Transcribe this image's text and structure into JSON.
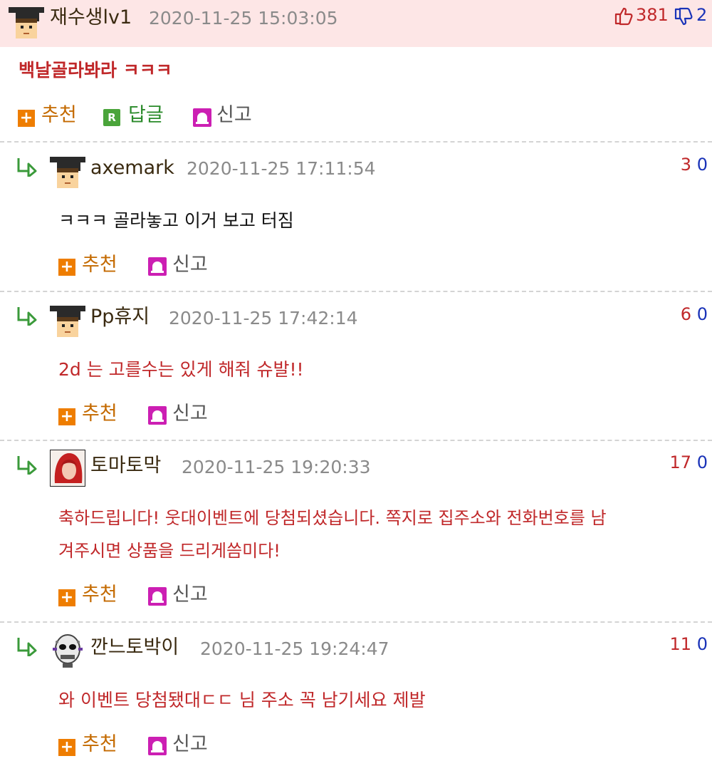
{
  "main_comment": {
    "author": "재수생lv1",
    "timestamp": "2020-11-25 15:03:05",
    "upvotes": "381",
    "downvotes": "2",
    "text": "백날골라봐라 ㅋㅋㅋ",
    "actions": {
      "recommend": "추천",
      "reply": "답글",
      "report": "신고"
    }
  },
  "replies": [
    {
      "author": "axemark",
      "timestamp": "2020-11-25 17:11:54",
      "up": "3",
      "down": "0",
      "lines": [
        "ㅋㅋㅋ 골라놓고 이거 보고 터짐"
      ],
      "recommend": "추천",
      "report": "신고"
    },
    {
      "author": "Pp휴지",
      "timestamp": "2020-11-25 17:42:14",
      "up": "6",
      "down": "0",
      "lines": [
        "2d 는 고를수는 있게 해줘 슈발!!"
      ],
      "recommend": "추천",
      "report": "신고"
    },
    {
      "author": "토마토막",
      "timestamp": "2020-11-25 19:20:33",
      "up": "17",
      "down": "0",
      "lines": [
        "축하드립니다! 웃대이벤트에 당첨되셨습니다. 쪽지로 집주소와 전화번호를 남",
        "겨주시면 상품을 드리게씀미다!"
      ],
      "recommend": "추천",
      "report": "신고"
    },
    {
      "author": "깐느토박이",
      "timestamp": "2020-11-25 19:24:47",
      "up": "11",
      "down": "0",
      "lines": [
        "와 이벤트 당첨됐대ㄷㄷ 님 주소 꼭 남기세요 제발"
      ],
      "recommend": "추천",
      "report": "신고"
    }
  ],
  "icons": {
    "thumbs_up": "thumbs-up-icon",
    "thumbs_down": "thumbs-down-icon",
    "plus": "plus-icon",
    "reply_r": "reply-r-icon",
    "report": "siren-icon",
    "reply_arrow": "reply-arrow-icon"
  },
  "colors": {
    "header_bg": "#fde6e6",
    "upvote": "#c0282a",
    "downvote": "#1a33b8",
    "comment_text_red": "#c0282a",
    "recommend": "#ee7d00",
    "reply": "#4aa43a",
    "report": "#cc1fb3"
  }
}
